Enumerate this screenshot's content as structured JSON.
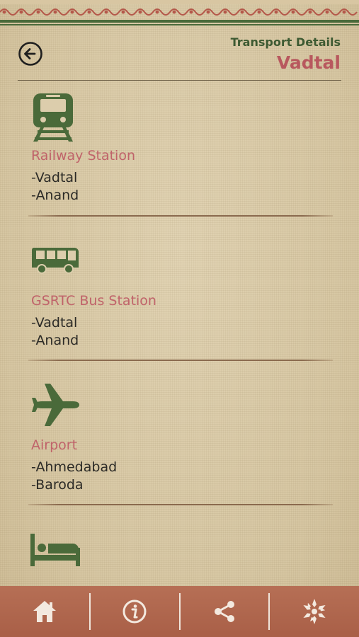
{
  "header": {
    "subtitle": "Transport Details",
    "title": "Vadtal"
  },
  "sections": [
    {
      "icon": "train-icon",
      "title": "Railway Station",
      "lines": [
        "-Vadtal",
        "-Anand"
      ]
    },
    {
      "icon": "bus-icon",
      "title": "GSRTC Bus Station",
      "lines": [
        "-Vadtal",
        "-Anand"
      ]
    },
    {
      "icon": "airplane-icon",
      "title": "Airport",
      "lines": [
        "-Ahmedabad",
        "-Baroda"
      ]
    },
    {
      "icon": "bed-icon",
      "title": "",
      "lines": []
    }
  ],
  "bottom_nav": [
    "home-icon",
    "info-icon",
    "share-icon",
    "temple-emblem-icon"
  ],
  "colors": {
    "accent_title": "#b8585e",
    "icon_green": "#4a6a3a",
    "bottom_bar": "#ad6249"
  }
}
